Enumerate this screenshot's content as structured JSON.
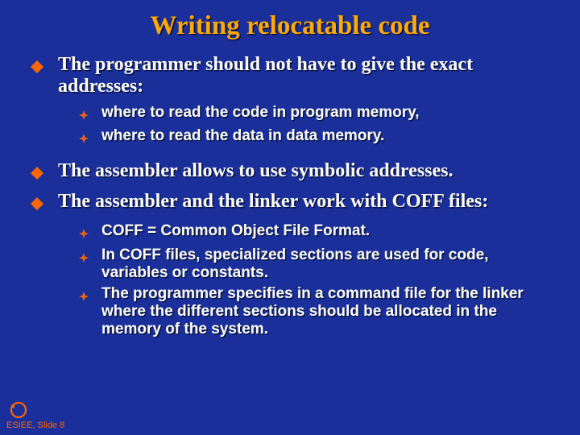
{
  "title": "Writing relocatable code",
  "bullets": [
    {
      "text": "The programmer should not have to give the exact addresses:",
      "sub": [
        "where to read the code in program memory,",
        "where to read the data in data memory."
      ]
    },
    {
      "text": "The assembler allows to use symbolic addresses.",
      "sub": []
    },
    {
      "text": "The assembler and the linker work with COFF files:",
      "sub": [
        "COFF = Common Object File Format.",
        "In COFF files, specialized sections are used for code, variables or constants.",
        "The programmer specifies in a command file for the linker where the different sections should be allocated in the memory of the system."
      ]
    }
  ],
  "footer": {
    "org": "ESIEE",
    "slide_prefix": "Slide",
    "slide_number": "8"
  },
  "colors": {
    "bg": "#1a2f99",
    "title": "#ffaa00",
    "text": "#ffffff",
    "accent": "#ff6600"
  }
}
